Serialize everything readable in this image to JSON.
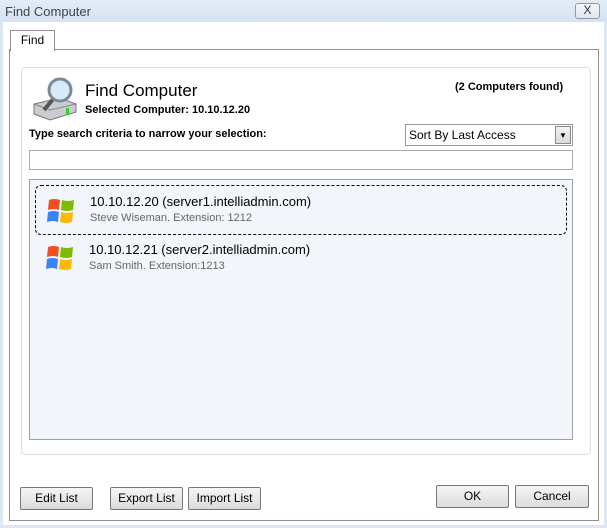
{
  "window": {
    "title": "Find Computer",
    "close_label": "X"
  },
  "tabs": [
    {
      "label": "Find"
    }
  ],
  "header": {
    "title": "Find Computer",
    "selected": "Selected Computer: 10.10.12.20",
    "count": "(2 Computers found)"
  },
  "search": {
    "label": "Type search criteria to narrow your selection:",
    "value": "",
    "sort": "Sort By Last Access"
  },
  "computers": [
    {
      "ip": "10.10.12.20 (server1.intelliadmin.com)",
      "detail": "Steve Wiseman. Extension: 1212",
      "selected": true
    },
    {
      "ip": "10.10.12.21 (server2.intelliadmin.com)",
      "detail": "Sam Smith. Extension:1213",
      "selected": false
    }
  ],
  "buttons": {
    "edit": "Edit List",
    "export": "Export List",
    "import": "Import List",
    "ok": "OK",
    "cancel": "Cancel"
  }
}
